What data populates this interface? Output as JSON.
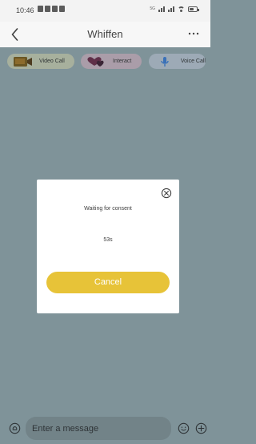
{
  "status_bar": {
    "time": "10:46",
    "network_label": "5G",
    "battery_level": 0.65,
    "icons": {
      "left": [
        "app-notification-icon",
        "shield-icon",
        "message-icon",
        "location-icon"
      ],
      "right": [
        "network-icon",
        "signal-icon",
        "wifi-icon",
        "battery-icon"
      ]
    }
  },
  "header": {
    "title": "Whiffen",
    "back_icon": "chevron-left-icon",
    "more_icon": "more-horizontal-icon"
  },
  "actions": [
    {
      "label": "Video Call",
      "icon": "video-camera-icon",
      "color": "#a7b09d"
    },
    {
      "label": "Interact",
      "icon": "heart-interact-icon",
      "color": "#aa9da9"
    },
    {
      "label": "Voice Call",
      "icon": "microphone-icon",
      "color": "#9daab6"
    }
  ],
  "dialog": {
    "message": "Waiting for consent",
    "countdown": "53s",
    "cancel_label": "Cancel",
    "close_icon": "close-icon",
    "accent_color": "#e7c338"
  },
  "composer": {
    "placeholder": "Enter a message",
    "left_icon": "voice-input-icon",
    "emoji_icon": "emoji-icon",
    "plus_icon": "plus-icon"
  },
  "colors": {
    "chat_background": "#7f9399",
    "status_background": "#f3f3f3",
    "header_background": "#f7f7f7"
  }
}
